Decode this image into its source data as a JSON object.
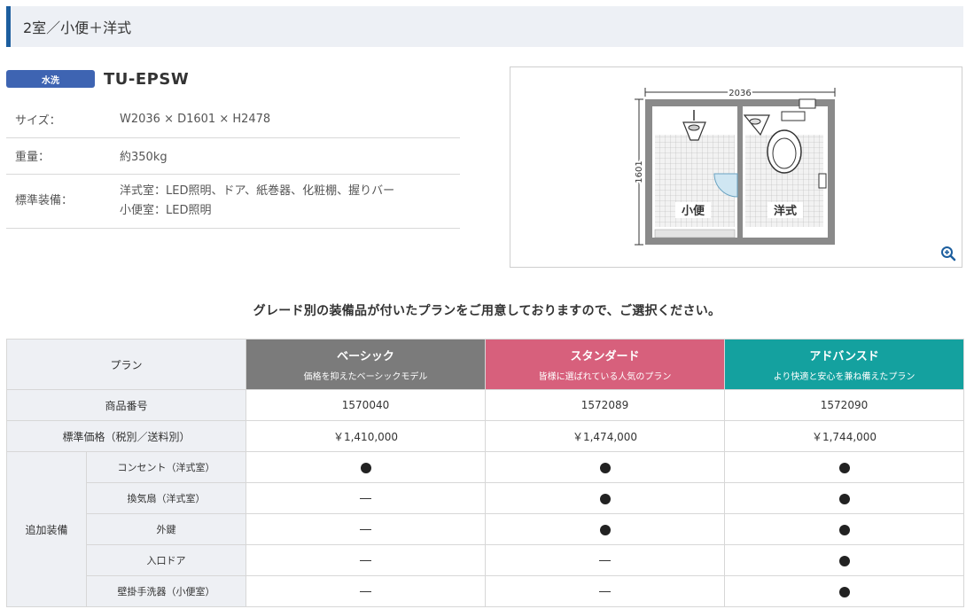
{
  "section_title": "2室／小便＋洋式",
  "product": {
    "badge": "水洗",
    "model": "TU-EPSW",
    "specs": [
      {
        "key": "サイズ：",
        "value": "W2036 × D1601 × H2478"
      },
      {
        "key": "重量：",
        "value": "約350kg"
      },
      {
        "key": "標準装備：",
        "value_lines": [
          "洋式室：LED照明、ドア、紙巻器、化粧棚、握りバー",
          "小便室：LED照明"
        ]
      }
    ]
  },
  "floorplan": {
    "width_label": "2036",
    "depth_label": "1601",
    "room_left": "小便",
    "room_right": "洋式",
    "zoom_icon": "zoom-in-icon"
  },
  "lead_text": "グレード別の装備品が付いたプランをご用意しておりますので、ご選択ください。",
  "grade_table": {
    "plan_label": "プラン",
    "grades": [
      {
        "name": "ベーシック",
        "desc": "価格を抑えたベーシックモデル",
        "color": "#7b7b7b"
      },
      {
        "name": "スタンダード",
        "desc": "皆様に選ばれている人気のプラン",
        "color": "#d7607c"
      },
      {
        "name": "アドバンスド",
        "desc": "より快適と安心を兼ね備えたプラン",
        "color": "#14a19f"
      }
    ],
    "product_no_label": "商品番号",
    "product_nos": [
      "1570040",
      "1572089",
      "1572090"
    ],
    "price_label": "標準価格（税別／送料別）",
    "prices": [
      "￥1,410,000",
      "￥1,474,000",
      "￥1,744,000"
    ],
    "options_label": "追加装備",
    "options": [
      {
        "name": "コンセント（洋式室）",
        "marks": [
          "dot",
          "dot",
          "dot"
        ]
      },
      {
        "name": "換気扇（洋式室）",
        "marks": [
          "dash",
          "dot",
          "dot"
        ]
      },
      {
        "name": "外鍵",
        "marks": [
          "dash",
          "dot",
          "dot"
        ]
      },
      {
        "name": "入口ドア",
        "marks": [
          "dash",
          "dash",
          "dot"
        ]
      },
      {
        "name": "壁掛手洗器（小便室）",
        "marks": [
          "dash",
          "dash",
          "dot"
        ]
      }
    ]
  }
}
